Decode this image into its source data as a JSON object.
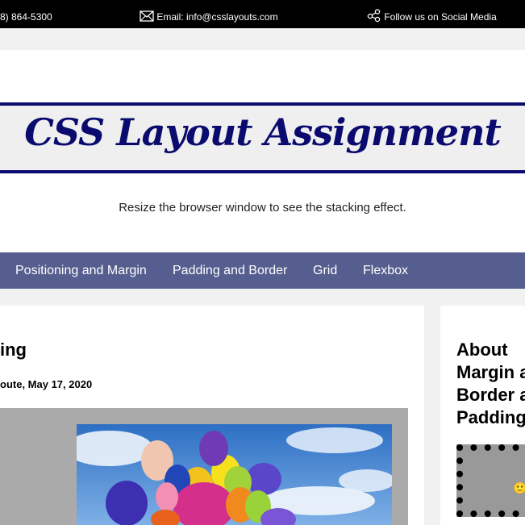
{
  "topbar": {
    "phone": "8) 864-5300",
    "email": "Email: info@csslayouts.com",
    "social": "Follow us on Social Media",
    "icons": [
      "envelope-icon",
      "share-icon"
    ]
  },
  "header": {
    "title": "CSS Layout Assignment",
    "tagline": "Resize the browser window to see the stacking effect."
  },
  "nav": {
    "items": [
      {
        "label": "Positioning and Margin"
      },
      {
        "label": "Padding and Border"
      },
      {
        "label": "Grid"
      },
      {
        "label": "Flexbox"
      }
    ]
  },
  "main": {
    "post_title": "ing",
    "post_meta": "oute, May 17, 2020",
    "image_alt": "balloons against a blue sky"
  },
  "sidebar": {
    "title": "About Margin and Border and Padding",
    "demo_icon": "🙂"
  },
  "colors": {
    "topbar": "#000000",
    "accent": "#0b0b6f",
    "nav": "#555e8f",
    "background": "#f1f1f1"
  }
}
